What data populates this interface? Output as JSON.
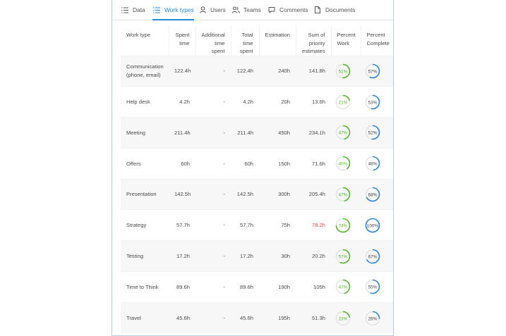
{
  "tabs": [
    {
      "label": "Data",
      "icon": "list-icon",
      "active": false
    },
    {
      "label": "Work types",
      "icon": "list-icon",
      "active": true
    },
    {
      "label": "Users",
      "icon": "user-icon",
      "active": false
    },
    {
      "label": "Teams",
      "icon": "team-icon",
      "active": false
    },
    {
      "label": "Comments",
      "icon": "comment-icon",
      "active": false
    },
    {
      "label": "Documents",
      "icon": "document-icon",
      "active": false
    }
  ],
  "table": {
    "headers": {
      "work_type": "Work type",
      "spent": "Spent time",
      "additional": "Additional time spent",
      "total": "Total time spent",
      "estimation": "Estimation",
      "priority": "Sum of priority estimates",
      "percent_work": "Percent Work",
      "percent_complete": "Percent Complete"
    },
    "rows": [
      {
        "work_type": "Communication (phone, email)",
        "spent": "122.4h",
        "additional": "-",
        "total": "122.4h",
        "estimation": "240h",
        "priority": "141.8h",
        "priority_over": false,
        "percent_work": "51%",
        "percent_work_value": 51,
        "percent_complete": "57%",
        "percent_complete_value": 57
      },
      {
        "work_type": "Help desk",
        "spent": "4.2h",
        "additional": "-",
        "total": "4.2h",
        "estimation": "20h",
        "priority": "13.6h",
        "priority_over": false,
        "percent_work": "21%",
        "percent_work_value": 21,
        "percent_complete": "53%",
        "percent_complete_value": 53
      },
      {
        "work_type": "Meeting",
        "spent": "211.4h",
        "additional": "-",
        "total": "211.4h",
        "estimation": "450h",
        "priority": "234.1h",
        "priority_over": false,
        "percent_work": "47%",
        "percent_work_value": 47,
        "percent_complete": "52%",
        "percent_complete_value": 52
      },
      {
        "work_type": "Offers",
        "spent": "60h",
        "additional": "-",
        "total": "60h",
        "estimation": "150h",
        "priority": "71.6h",
        "priority_over": false,
        "percent_work": "40%",
        "percent_work_value": 40,
        "percent_complete": "48%",
        "percent_complete_value": 48
      },
      {
        "work_type": "Presentation",
        "spent": "142.5h",
        "additional": "-",
        "total": "142.5h",
        "estimation": "300h",
        "priority": "205.4h",
        "priority_over": false,
        "percent_work": "47%",
        "percent_work_value": 47,
        "percent_complete": "68%",
        "percent_complete_value": 68
      },
      {
        "work_type": "Strategy",
        "spent": "57.7h",
        "additional": "-",
        "total": "57.7h",
        "estimation": "75h",
        "priority": "78.2h",
        "priority_over": true,
        "percent_work": "74%",
        "percent_work_value": 74,
        "percent_complete": "100%",
        "percent_complete_value": 100
      },
      {
        "work_type": "Testing",
        "spent": "17.2h",
        "additional": "-",
        "total": "17.2h",
        "estimation": "30h",
        "priority": "20.2h",
        "priority_over": false,
        "percent_work": "57%",
        "percent_work_value": 57,
        "percent_complete": "67%",
        "percent_complete_value": 67
      },
      {
        "work_type": "Time to Think",
        "spent": "89.6h",
        "additional": "-",
        "total": "89.6h",
        "estimation": "190h",
        "priority": "105h",
        "priority_over": false,
        "percent_work": "47%",
        "percent_work_value": 47,
        "percent_complete": "55%",
        "percent_complete_value": 55
      },
      {
        "work_type": "Travel",
        "spent": "45.6h",
        "additional": "-",
        "total": "45.6h",
        "estimation": "195h",
        "priority": "51.3h",
        "priority_over": false,
        "percent_work": "23%",
        "percent_work_value": 23,
        "percent_complete": "26%",
        "percent_complete_value": 26
      }
    ]
  },
  "colors": {
    "accent": "#1f8ad8",
    "work_ring": "#52b52e",
    "complete_ring": "#2b87d6",
    "over_estimate": "#e84646",
    "ring_track": "#e3e3e3"
  }
}
